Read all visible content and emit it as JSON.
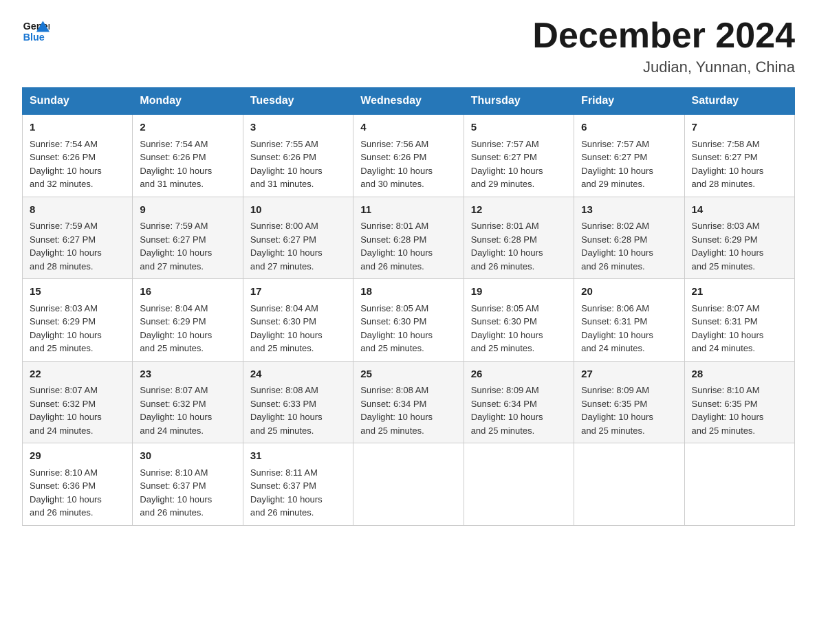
{
  "logo": {
    "general": "General",
    "blue": "Blue"
  },
  "title": "December 2024",
  "subtitle": "Judian, Yunnan, China",
  "days_of_week": [
    "Sunday",
    "Monday",
    "Tuesday",
    "Wednesday",
    "Thursday",
    "Friday",
    "Saturday"
  ],
  "weeks": [
    [
      {
        "day": "1",
        "sunrise": "7:54 AM",
        "sunset": "6:26 PM",
        "daylight": "10 hours and 32 minutes."
      },
      {
        "day": "2",
        "sunrise": "7:54 AM",
        "sunset": "6:26 PM",
        "daylight": "10 hours and 31 minutes."
      },
      {
        "day": "3",
        "sunrise": "7:55 AM",
        "sunset": "6:26 PM",
        "daylight": "10 hours and 31 minutes."
      },
      {
        "day": "4",
        "sunrise": "7:56 AM",
        "sunset": "6:26 PM",
        "daylight": "10 hours and 30 minutes."
      },
      {
        "day": "5",
        "sunrise": "7:57 AM",
        "sunset": "6:27 PM",
        "daylight": "10 hours and 29 minutes."
      },
      {
        "day": "6",
        "sunrise": "7:57 AM",
        "sunset": "6:27 PM",
        "daylight": "10 hours and 29 minutes."
      },
      {
        "day": "7",
        "sunrise": "7:58 AM",
        "sunset": "6:27 PM",
        "daylight": "10 hours and 28 minutes."
      }
    ],
    [
      {
        "day": "8",
        "sunrise": "7:59 AM",
        "sunset": "6:27 PM",
        "daylight": "10 hours and 28 minutes."
      },
      {
        "day": "9",
        "sunrise": "7:59 AM",
        "sunset": "6:27 PM",
        "daylight": "10 hours and 27 minutes."
      },
      {
        "day": "10",
        "sunrise": "8:00 AM",
        "sunset": "6:27 PM",
        "daylight": "10 hours and 27 minutes."
      },
      {
        "day": "11",
        "sunrise": "8:01 AM",
        "sunset": "6:28 PM",
        "daylight": "10 hours and 26 minutes."
      },
      {
        "day": "12",
        "sunrise": "8:01 AM",
        "sunset": "6:28 PM",
        "daylight": "10 hours and 26 minutes."
      },
      {
        "day": "13",
        "sunrise": "8:02 AM",
        "sunset": "6:28 PM",
        "daylight": "10 hours and 26 minutes."
      },
      {
        "day": "14",
        "sunrise": "8:03 AM",
        "sunset": "6:29 PM",
        "daylight": "10 hours and 25 minutes."
      }
    ],
    [
      {
        "day": "15",
        "sunrise": "8:03 AM",
        "sunset": "6:29 PM",
        "daylight": "10 hours and 25 minutes."
      },
      {
        "day": "16",
        "sunrise": "8:04 AM",
        "sunset": "6:29 PM",
        "daylight": "10 hours and 25 minutes."
      },
      {
        "day": "17",
        "sunrise": "8:04 AM",
        "sunset": "6:30 PM",
        "daylight": "10 hours and 25 minutes."
      },
      {
        "day": "18",
        "sunrise": "8:05 AM",
        "sunset": "6:30 PM",
        "daylight": "10 hours and 25 minutes."
      },
      {
        "day": "19",
        "sunrise": "8:05 AM",
        "sunset": "6:30 PM",
        "daylight": "10 hours and 25 minutes."
      },
      {
        "day": "20",
        "sunrise": "8:06 AM",
        "sunset": "6:31 PM",
        "daylight": "10 hours and 24 minutes."
      },
      {
        "day": "21",
        "sunrise": "8:07 AM",
        "sunset": "6:31 PM",
        "daylight": "10 hours and 24 minutes."
      }
    ],
    [
      {
        "day": "22",
        "sunrise": "8:07 AM",
        "sunset": "6:32 PM",
        "daylight": "10 hours and 24 minutes."
      },
      {
        "day": "23",
        "sunrise": "8:07 AM",
        "sunset": "6:32 PM",
        "daylight": "10 hours and 24 minutes."
      },
      {
        "day": "24",
        "sunrise": "8:08 AM",
        "sunset": "6:33 PM",
        "daylight": "10 hours and 25 minutes."
      },
      {
        "day": "25",
        "sunrise": "8:08 AM",
        "sunset": "6:34 PM",
        "daylight": "10 hours and 25 minutes."
      },
      {
        "day": "26",
        "sunrise": "8:09 AM",
        "sunset": "6:34 PM",
        "daylight": "10 hours and 25 minutes."
      },
      {
        "day": "27",
        "sunrise": "8:09 AM",
        "sunset": "6:35 PM",
        "daylight": "10 hours and 25 minutes."
      },
      {
        "day": "28",
        "sunrise": "8:10 AM",
        "sunset": "6:35 PM",
        "daylight": "10 hours and 25 minutes."
      }
    ],
    [
      {
        "day": "29",
        "sunrise": "8:10 AM",
        "sunset": "6:36 PM",
        "daylight": "10 hours and 26 minutes."
      },
      {
        "day": "30",
        "sunrise": "8:10 AM",
        "sunset": "6:37 PM",
        "daylight": "10 hours and 26 minutes."
      },
      {
        "day": "31",
        "sunrise": "8:11 AM",
        "sunset": "6:37 PM",
        "daylight": "10 hours and 26 minutes."
      },
      null,
      null,
      null,
      null
    ]
  ],
  "sunrise_label": "Sunrise:",
  "sunset_label": "Sunset:",
  "daylight_label": "Daylight:"
}
